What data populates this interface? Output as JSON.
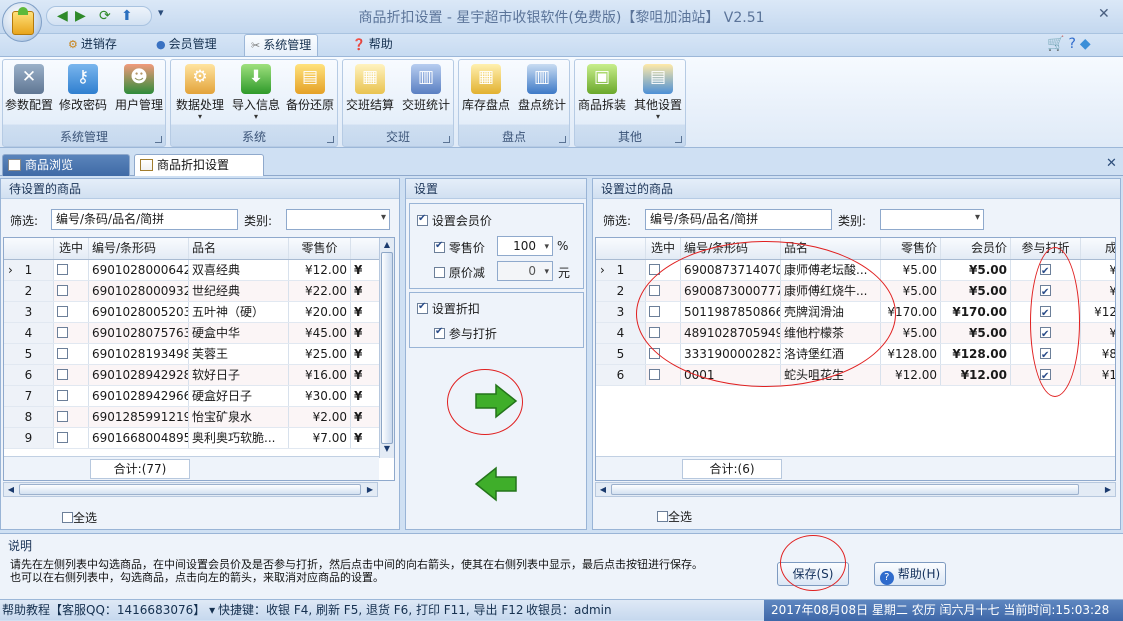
{
  "window": {
    "title": "商品折扣设置 - 星宇超市收银软件(免费版)【黎咀加油站】 V2.51",
    "close": "✕"
  },
  "menu": {
    "tabs": [
      "进销存",
      "会员管理",
      "系统管理",
      "帮助"
    ],
    "selected": 2
  },
  "ribbon": {
    "groups": [
      {
        "label": "系统管理",
        "buttons": [
          "参数配置",
          "修改密码",
          "用户管理"
        ]
      },
      {
        "label": "系统",
        "buttons": [
          "数据处理",
          "导入信息",
          "备份还原"
        ]
      },
      {
        "label": "交班",
        "buttons": [
          "交班结算",
          "交班统计"
        ]
      },
      {
        "label": "盘点",
        "buttons": [
          "库存盘点",
          "盘点统计"
        ]
      },
      {
        "label": "其他",
        "buttons": [
          "商品拆装",
          "其他设置"
        ]
      }
    ]
  },
  "doc_tabs": [
    "商品浏览",
    "商品折扣设置"
  ],
  "left": {
    "title": "待设置的商品",
    "filter_label": "筛选:",
    "filter_value": "编号/条码/品名/简拼",
    "category_label": "类别:",
    "columns": [
      "选中",
      "编号/条形码",
      "品名",
      "零售价"
    ],
    "rows": [
      {
        "i": "1",
        "code": "6901028000642",
        "name": "双喜经典",
        "price": "¥12.00"
      },
      {
        "i": "2",
        "code": "6901028000932",
        "name": "世纪经典",
        "price": "¥22.00"
      },
      {
        "i": "3",
        "code": "6901028005203",
        "name": "五叶神（硬）",
        "price": "¥20.00"
      },
      {
        "i": "4",
        "code": "6901028075763",
        "name": "硬盒中华",
        "price": "¥45.00"
      },
      {
        "i": "5",
        "code": "6901028193498",
        "name": "芙蓉王",
        "price": "¥25.00"
      },
      {
        "i": "6",
        "code": "6901028942928",
        "name": "软好日子",
        "price": "¥16.00"
      },
      {
        "i": "7",
        "code": "6901028942966",
        "name": "硬盒好日子",
        "price": "¥30.00"
      },
      {
        "i": "8",
        "code": "6901285991219",
        "name": "怡宝矿泉水",
        "price": "¥2.00"
      },
      {
        "i": "9",
        "code": "6901668004895",
        "name": "奥利奥巧软脆...",
        "price": "¥7.00"
      }
    ],
    "extra_col": "¥",
    "total": "合计:(77)",
    "select_all": "全选"
  },
  "middle": {
    "title": "设置",
    "member_price": "设置会员价",
    "retail_label": "零售价",
    "retail_value": "100",
    "percent": "%",
    "orig_label": "原价减",
    "orig_value": "0",
    "yuan": "元",
    "set_discount": "设置折扣",
    "join_discount": "参与打折"
  },
  "right": {
    "title": "设置过的商品",
    "filter_label": "筛选:",
    "filter_value": "编号/条码/品名/简拼",
    "category_label": "类别:",
    "columns": [
      "选中",
      "编号/条形码",
      "品名",
      "零售价",
      "会员价",
      "参与打折",
      "成"
    ],
    "rows": [
      {
        "i": "1",
        "code": "6900873714070",
        "name": "康师傅老坛酸...",
        "price": "¥5.00",
        "member": "¥5.00",
        "extra": "¥"
      },
      {
        "i": "2",
        "code": "6900873000777",
        "name": "康师傅红烧牛...",
        "price": "¥5.00",
        "member": "¥5.00",
        "extra": "¥"
      },
      {
        "i": "3",
        "code": "5011987850866",
        "name": "壳牌润滑油",
        "price": "¥170.00",
        "member": "¥170.00",
        "extra": "¥12"
      },
      {
        "i": "4",
        "code": "4891028705949",
        "name": "维他柠檬茶",
        "price": "¥5.00",
        "member": "¥5.00",
        "extra": "¥"
      },
      {
        "i": "5",
        "code": "3331900002823",
        "name": "洛诗堡红酒",
        "price": "¥128.00",
        "member": "¥128.00",
        "extra": "¥8"
      },
      {
        "i": "6",
        "code": "0001",
        "name": "蛇头咀花生",
        "price": "¥12.00",
        "member": "¥12.00",
        "extra": "¥1"
      }
    ],
    "total": "合计:(6)",
    "select_all": "全选"
  },
  "note": {
    "title": "说明",
    "line1": "请先在左侧列表中勾选商品，在中间设置会员价及是否参与打折，然后点击中间的向右箭头，使其在右侧列表中显示，最后点击按钮进行保存。",
    "line2": "也可以在右侧列表中，勾选商品，点击向左的箭头，来取消对应商品的设置。",
    "save": "保存(S)",
    "help": "帮助(H)"
  },
  "status": {
    "tutorial": "帮助教程【客服QQ：1416683076】",
    "shortcuts": "快捷键：收银 F4, 刷新 F5, 退货 F6, 打印 F11, 导出 F12",
    "cashier": "收银员：admin",
    "datetime": "2017年08月08日 星期二 农历 闰六月十七 当前时间:15:03:28"
  },
  "colors": {
    "accent": "#3e67a8",
    "arrow_green": "#3fae2a",
    "annotation_red": "#e02020"
  }
}
